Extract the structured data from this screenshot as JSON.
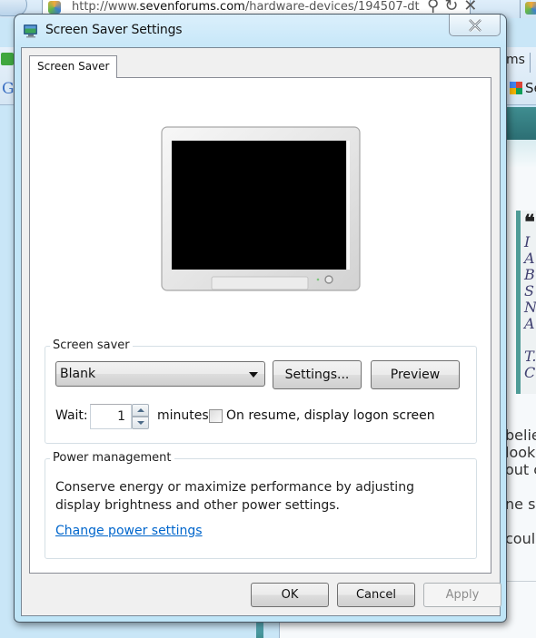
{
  "background_browser": {
    "address_url_prefix": "http://www.",
    "address_url_host": "sevenforums.com",
    "address_url_path": "/hardware-devices/194507-dt",
    "toolbar_partial_text": "ms",
    "google_partial_text": "Se",
    "quote_lines": [
      "I",
      "A",
      "B",
      "S",
      "N",
      "A",
      "",
      "T.",
      "C."
    ],
    "body_partial_lines": [
      "belie",
      "look",
      "out c",
      "",
      "ne se",
      "",
      "coul"
    ]
  },
  "dialog": {
    "title": "Screen Saver Settings",
    "close_icon": "close-x-icon",
    "tabs": [
      {
        "label": "Screen Saver",
        "active": true
      }
    ],
    "preview": {
      "icon": "monitor-preview",
      "screen_color": "#000000"
    },
    "screen_saver_group": {
      "legend": "Screen saver",
      "selected_saver": "Blank",
      "settings_button": "Settings...",
      "preview_button": "Preview",
      "wait_label": "Wait:",
      "wait_value": "1",
      "minutes_label": "minutes",
      "logon_checkbox_label": "On resume, display logon screen",
      "logon_checkbox_checked": false
    },
    "power_group": {
      "legend": "Power management",
      "description_line1": "Conserve energy or maximize performance by adjusting",
      "description_line2": "display brightness and other power settings.",
      "link": "Change power settings",
      "link_color": "#0066cc"
    },
    "buttons": {
      "ok": "OK",
      "cancel": "Cancel",
      "apply": "Apply",
      "apply_enabled": false
    }
  }
}
